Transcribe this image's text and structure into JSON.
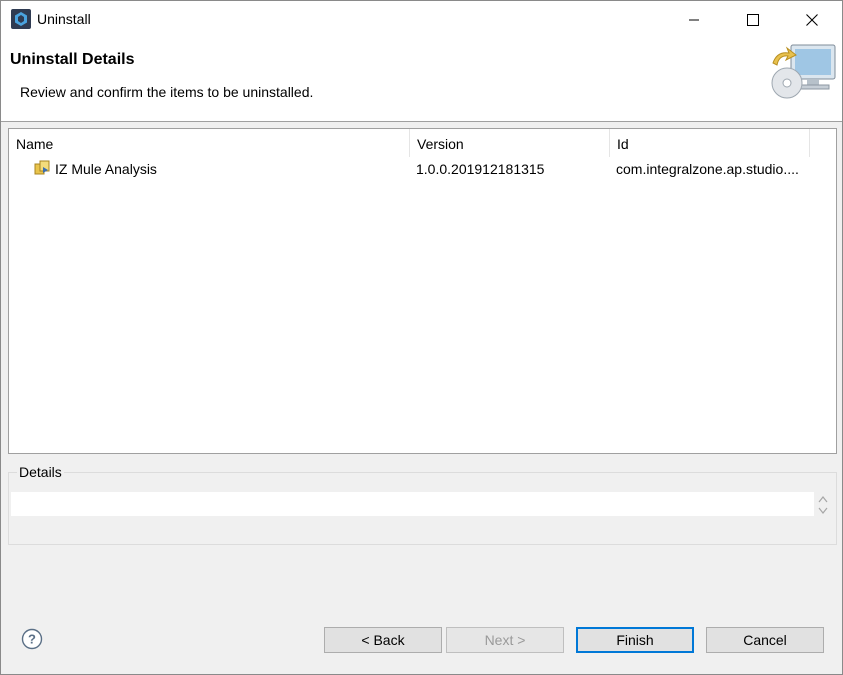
{
  "window": {
    "title": "Uninstall"
  },
  "header": {
    "title": "Uninstall Details",
    "description": "Review and confirm the items to be uninstalled."
  },
  "table": {
    "columns": [
      "Name",
      "Version",
      "Id"
    ],
    "rows": [
      {
        "name": "IZ Mule Analysis",
        "version": "1.0.0.201912181315",
        "id": "com.integralzone.ap.studio...."
      }
    ]
  },
  "details": {
    "label": "Details",
    "text": ""
  },
  "buttons": {
    "back": "< Back",
    "next": "Next >",
    "finish": "Finish",
    "cancel": "Cancel"
  },
  "colors": {
    "accent": "#0078d7",
    "window_bg": "#f0f0f0"
  }
}
